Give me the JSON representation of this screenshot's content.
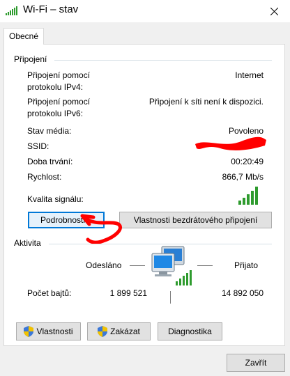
{
  "window": {
    "title": "Wi-Fi – stav",
    "close_label": "×"
  },
  "tab": {
    "label": "Obecné"
  },
  "connection": {
    "header": "Připojení",
    "ipv4_label_line1": "Připojení pomocí",
    "ipv4_label_line2": "protokolu IPv4:",
    "ipv4_value": "Internet",
    "ipv6_label_line1": "Připojení pomocí",
    "ipv6_label_line2": "protokolu IPv6:",
    "ipv6_value": "Připojení k síti není k dispozici.",
    "media_label": "Stav média:",
    "media_value": "Povoleno",
    "ssid_label": "SSID:",
    "ssid_value": "",
    "duration_label": "Doba trvání:",
    "duration_value": "00:20:49",
    "speed_label": "Rychlost:",
    "speed_value": "866,7 Mb/s",
    "signal_label": "Kvalita signálu:",
    "signal_bars": 5
  },
  "buttons": {
    "details": "Podrobnosti...",
    "wireless_props": "Vlastnosti bezdrátového připojení",
    "properties": "Vlastnosti",
    "disable": "Zakázat",
    "diagnose": "Diagnostika",
    "close": "Zavřít"
  },
  "activity": {
    "header": "Aktivita",
    "sent_label": "Odesláno",
    "received_label": "Přijato",
    "bytes_label": "Počet bajtů:",
    "bytes_sent": "1 899 521",
    "bytes_received": "14 892 050"
  },
  "colors": {
    "accent": "#0078d7",
    "signal_green": "#2e9b2e",
    "annotation_red": "#ff0000"
  }
}
